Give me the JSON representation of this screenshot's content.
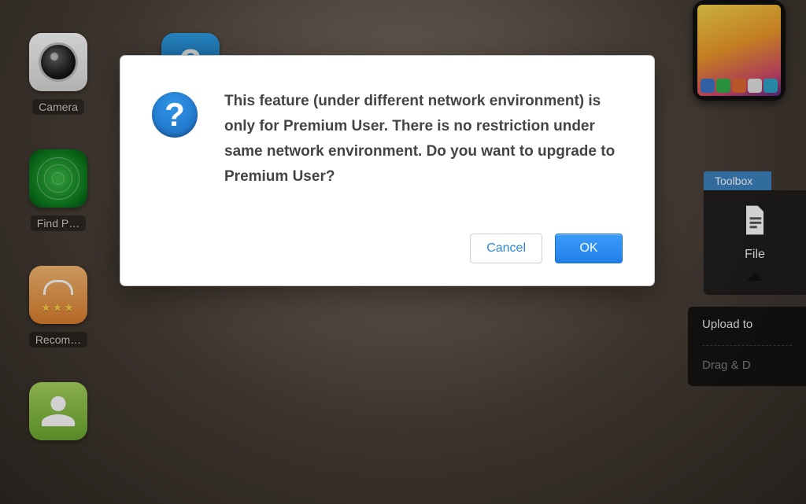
{
  "desktop": {
    "apps": [
      {
        "id": "camera",
        "label": "Camera"
      },
      {
        "id": "find-phone",
        "label": "Find P…"
      },
      {
        "id": "recommended",
        "label": "Recom…"
      },
      {
        "id": "contacts",
        "label": ""
      }
    ],
    "help_tile_glyph": "?"
  },
  "toolbox": {
    "tab_label": "Toolbox",
    "file_label": "File"
  },
  "upload": {
    "title": "Upload to",
    "drop_text": "Drag & D"
  },
  "dialog": {
    "icon_glyph": "?",
    "message": "This feature (under different network environment) is only for Premium User. There is no restriction under same network environment. Do you want to upgrade to Premium User?",
    "cancel_label": "Cancel",
    "ok_label": "OK"
  },
  "colors": {
    "primary": "#1f7fe8",
    "toolbox_tab": "#3d84c2"
  }
}
